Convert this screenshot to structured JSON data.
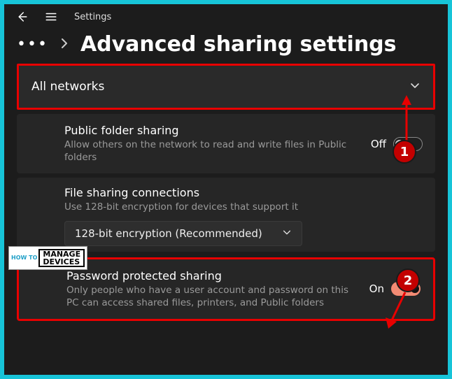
{
  "titlebar": {
    "title": "Settings"
  },
  "breadcrumb": {
    "page_title": "Advanced sharing settings"
  },
  "section": {
    "title": "All networks"
  },
  "public_folder": {
    "title": "Public folder sharing",
    "desc": "Allow others on the network to read and write files in Public folders",
    "state_label": "Off"
  },
  "file_sharing": {
    "title": "File sharing connections",
    "desc": "Use 128-bit encryption for devices that support it",
    "dropdown_value": "128-bit encryption (Recommended)"
  },
  "password_sharing": {
    "title": "Password protected sharing",
    "desc": "Only people who have a user account and password on this PC can access shared files, printers, and Public folders",
    "state_label": "On"
  },
  "annotations": {
    "marker1": "1",
    "marker2": "2"
  },
  "watermark": {
    "howto": "HOW TO",
    "manage": "MANAGE",
    "devices": "DEVICES"
  }
}
